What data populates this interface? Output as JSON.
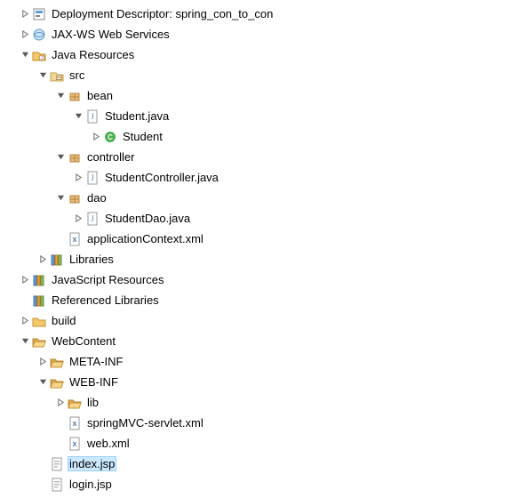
{
  "tree": [
    {
      "depth": 0,
      "twisty": "closed",
      "icon": "dd",
      "label": "Deployment Descriptor: spring_con_to_con",
      "selected": false
    },
    {
      "depth": 0,
      "twisty": "closed",
      "icon": "jaxws",
      "label": "JAX-WS Web Services",
      "selected": false
    },
    {
      "depth": 0,
      "twisty": "open",
      "icon": "javares",
      "label": "Java Resources",
      "selected": false
    },
    {
      "depth": 1,
      "twisty": "open",
      "icon": "srcfolder",
      "label": "src",
      "selected": false
    },
    {
      "depth": 2,
      "twisty": "open",
      "icon": "package",
      "label": "bean",
      "selected": false
    },
    {
      "depth": 3,
      "twisty": "open",
      "icon": "javafile",
      "label": "Student.java",
      "selected": false
    },
    {
      "depth": 4,
      "twisty": "closed",
      "icon": "class",
      "label": "Student",
      "selected": false
    },
    {
      "depth": 2,
      "twisty": "open",
      "icon": "package",
      "label": "controller",
      "selected": false
    },
    {
      "depth": 3,
      "twisty": "closed",
      "icon": "javafile",
      "label": "StudentController.java",
      "selected": false
    },
    {
      "depth": 2,
      "twisty": "open",
      "icon": "package",
      "label": "dao",
      "selected": false
    },
    {
      "depth": 3,
      "twisty": "closed",
      "icon": "javafile",
      "label": "StudentDao.java",
      "selected": false
    },
    {
      "depth": 2,
      "twisty": "none",
      "icon": "xmlfile",
      "label": "applicationContext.xml",
      "selected": false
    },
    {
      "depth": 1,
      "twisty": "closed",
      "icon": "library",
      "label": "Libraries",
      "selected": false
    },
    {
      "depth": 0,
      "twisty": "closed",
      "icon": "library",
      "label": "JavaScript Resources",
      "selected": false
    },
    {
      "depth": 0,
      "twisty": "none",
      "icon": "library",
      "label": "Referenced Libraries",
      "selected": false
    },
    {
      "depth": 0,
      "twisty": "closed",
      "icon": "folder",
      "label": "build",
      "selected": false
    },
    {
      "depth": 0,
      "twisty": "open",
      "icon": "folderopen",
      "label": "WebContent",
      "selected": false
    },
    {
      "depth": 1,
      "twisty": "closed",
      "icon": "folderopen",
      "label": "META-INF",
      "selected": false
    },
    {
      "depth": 1,
      "twisty": "open",
      "icon": "folderopen",
      "label": "WEB-INF",
      "selected": false
    },
    {
      "depth": 2,
      "twisty": "closed",
      "icon": "folderopen",
      "label": "lib",
      "selected": false
    },
    {
      "depth": 2,
      "twisty": "none",
      "icon": "xmlfile",
      "label": "springMVC-servlet.xml",
      "selected": false
    },
    {
      "depth": 2,
      "twisty": "none",
      "icon": "xmlfile",
      "label": "web.xml",
      "selected": false
    },
    {
      "depth": 1,
      "twisty": "none",
      "icon": "jspfile",
      "label": "index.jsp",
      "selected": true
    },
    {
      "depth": 1,
      "twisty": "none",
      "icon": "jspfile",
      "label": "login.jsp",
      "selected": false
    }
  ]
}
